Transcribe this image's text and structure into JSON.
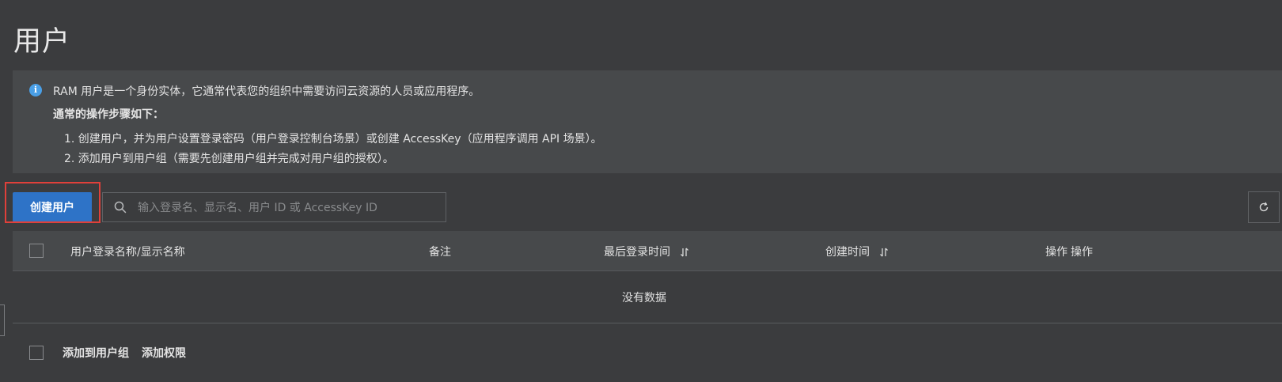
{
  "page": {
    "title": "用户"
  },
  "info": {
    "icon": "info-icon",
    "description": "RAM 用户是一个身份实体，它通常代表您的组织中需要访问云资源的人员或应用程序。",
    "steps_title": "通常的操作步骤如下：",
    "step1": "1. 创建用户，并为用户设置登录密码（用户登录控制台场景）或创建 AccessKey（应用程序调用 API 场景）。",
    "step2": "2. 添加用户到用户组（需要先创建用户组并完成对用户组的授权）。"
  },
  "toolbar": {
    "create_label": "创建用户",
    "search_placeholder": "输入登录名、显示名、用户 ID 或 AccessKey ID",
    "search_value": "",
    "refresh_icon": "refresh-icon"
  },
  "table": {
    "columns": [
      {
        "label": "用户登录名称/显示名称",
        "sortable": false
      },
      {
        "label": "备注",
        "sortable": false
      },
      {
        "label": "最后登录时间",
        "sortable": true
      },
      {
        "label": "创建时间",
        "sortable": true
      },
      {
        "label": "操作",
        "sortable": false
      }
    ],
    "truncated_column": "操作",
    "empty_text": "没有数据"
  },
  "footer": {
    "add_to_group": "添加到用户组",
    "add_permission": "添加权限"
  },
  "colors": {
    "background": "#3b3c3e",
    "panel": "#47494b",
    "primary": "#2e73c7",
    "highlight": "#e0403a",
    "info": "#4a9fe6"
  }
}
